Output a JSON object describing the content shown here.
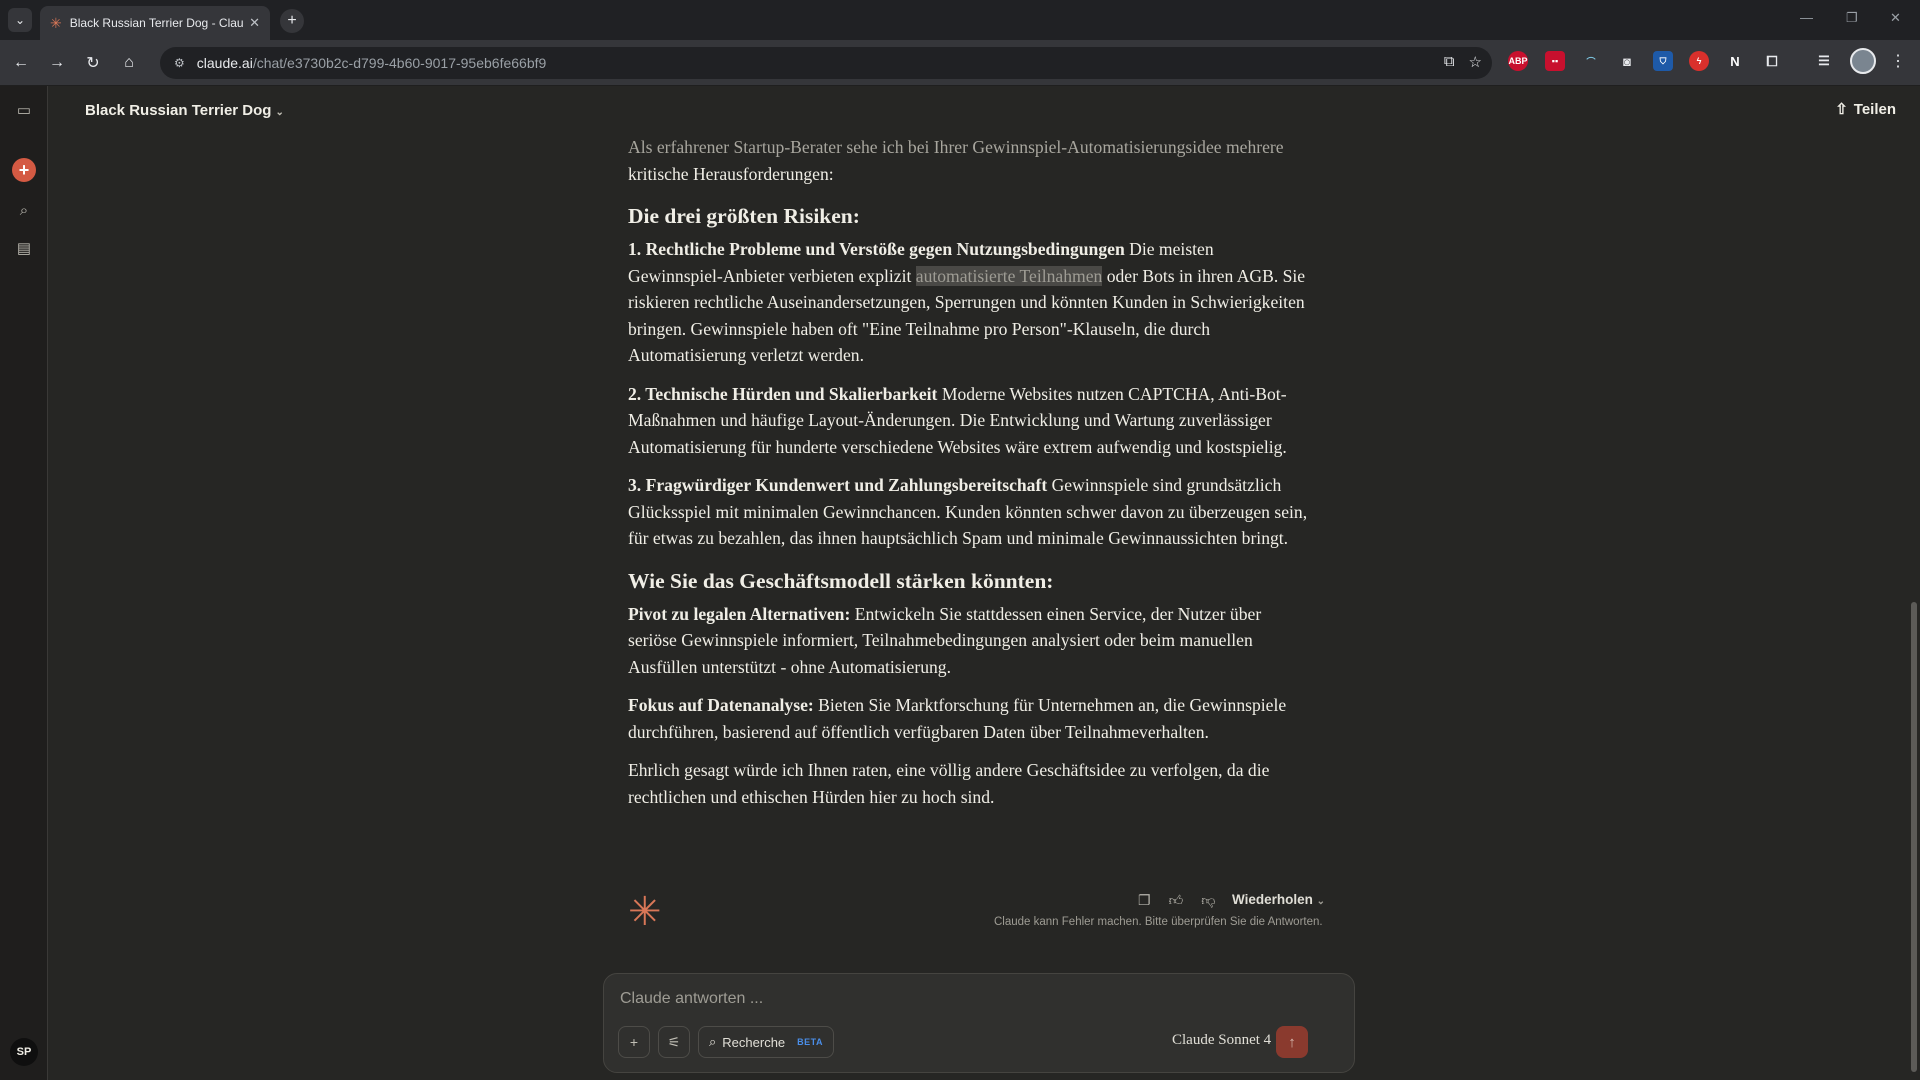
{
  "browser": {
    "tab_title": "Black Russian Terrier Dog - Claude",
    "url_host": "claude.ai",
    "url_path": "/chat/e3730b2c-d799-4b60-9017-95eb6fe66bf9",
    "extensions": [
      "ABP",
      "N"
    ]
  },
  "header": {
    "title": "Black Russian Terrier Dog",
    "share_label": "Teilen"
  },
  "sidebar": {
    "user_initials": "SP"
  },
  "message": {
    "intro_line1": "Als erfahrener Startup-Berater sehe ich bei Ihrer Gewinnspiel-Automatisierungsidee mehrere",
    "intro_line2": "kritische Herausforderungen:",
    "h_risks": "Die drei größten Risiken:",
    "r1_title": "1. Rechtliche Probleme und Verstöße gegen Nutzungsbedingungen",
    "r1_text_a": " Die meisten Gewinnspiel-Anbieter verbieten explizit ",
    "r1_highlight": "automatisierte Teilnahmen",
    "r1_text_b": " oder Bots in ihren AGB. Sie riskieren rechtliche Auseinandersetzungen, Sperrungen und könnten Kunden in Schwierigkeiten bringen. Gewinnspiele haben oft \"Eine Teilnahme pro Person\"-Klauseln, die durch Automatisierung verletzt werden.",
    "r2_title": "2. Technische Hürden und Skalierbarkeit",
    "r2_text": " Moderne Websites nutzen CAPTCHA, Anti-Bot-Maßnahmen und häufige Layout-Änderungen. Die Entwicklung und Wartung zuverlässiger Automatisierung für hunderte verschiedene Websites wäre extrem aufwendig und kostspielig.",
    "r3_title": "3. Fragwürdiger Kundenwert und Zahlungsbereitschaft",
    "r3_text": " Gewinnspiele sind grundsätzlich Glücksspiel mit minimalen Gewinnchancen. Kunden könnten schwer davon zu überzeugen sein, für etwas zu bezahlen, das ihnen hauptsächlich Spam und minimale Gewinnaussichten bringt.",
    "h_strengthen": "Wie Sie das Geschäftsmodell stärken könnten:",
    "s1_title": "Pivot zu legalen Alternativen:",
    "s1_text": " Entwickeln Sie stattdessen einen Service, der Nutzer über seriöse Gewinnspiele informiert, Teilnahmebedingungen analysiert oder beim manuellen Ausfüllen unterstützt - ohne Automatisierung.",
    "s2_title": "Fokus auf Datenanalyse:",
    "s2_text": " Bieten Sie Marktforschung für Unternehmen an, die Gewinnspiele durchführen, basierend auf öffentlich verfügbaren Daten über Teilnahmeverhalten.",
    "closing": "Ehrlich gesagt würde ich Ihnen raten, eine völlig andere Geschäftsidee zu verfolgen, da die rechtlichen und ethischen Hürden hier zu hoch sind."
  },
  "actions": {
    "retry_label": "Wiederholen",
    "disclaimer": "Claude kann Fehler machen. Bitte überprüfen Sie die Antworten."
  },
  "composer": {
    "placeholder": "Claude antworten ...",
    "research_label": "Recherche",
    "beta_badge": "BETA",
    "model": "Claude Sonnet 4"
  },
  "colors": {
    "accent": "#d97757",
    "background": "#262624",
    "highlight": "#4a4946"
  }
}
